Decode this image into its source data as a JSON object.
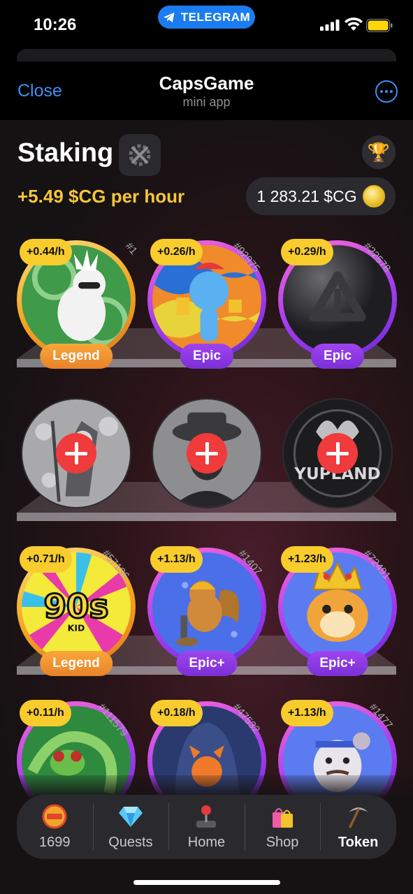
{
  "status_bar": {
    "time": "10:26",
    "pill_label": "TELEGRAM"
  },
  "header": {
    "close_label": "Close",
    "title": "CapsGame",
    "subtitle": "mini app"
  },
  "staking": {
    "title": "Staking",
    "rate_text": "+5.49 $CG per hour",
    "balance_text": "1 283.21 $CG"
  },
  "cards": [
    {
      "rate": "+0.44/h",
      "id": "#1",
      "rarity": "Legend",
      "tier": "legend"
    },
    {
      "rate": "+0.26/h",
      "id": "#92975",
      "rarity": "Epic",
      "tier": "epic"
    },
    {
      "rate": "+0.29/h",
      "id": "#22578",
      "rarity": "Epic",
      "tier": "epic"
    },
    {
      "empty": true,
      "art": "coins-figure"
    },
    {
      "empty": true,
      "art": "hat-man"
    },
    {
      "empty": true,
      "art": "yupland",
      "art_text": "YUPLAND"
    },
    {
      "rate": "+0.71/h",
      "id": "#57136",
      "rarity": "Legend",
      "tier": "legend",
      "art_text": "90s",
      "art_sub": "KID"
    },
    {
      "rate": "+1.13/h",
      "id": "#1407",
      "rarity": "Epic+",
      "tier": "epic"
    },
    {
      "rate": "+1.23/h",
      "id": "#72491",
      "rarity": "Epic+",
      "tier": "epic"
    },
    {
      "rate": "+0.11/h",
      "id": "#111579",
      "tier": "epic"
    },
    {
      "rate": "+0.18/h",
      "id": "#47532",
      "tier": "epic"
    },
    {
      "rate": "+1.13/h",
      "id": "#1477",
      "tier": "epic"
    }
  ],
  "nav": {
    "items": [
      {
        "label": "1699",
        "icon": "capsgame-logo-icon"
      },
      {
        "label": "Quests",
        "icon": "diamond-icon"
      },
      {
        "label": "Home",
        "icon": "joystick-icon"
      },
      {
        "label": "Shop",
        "icon": "shopping-bags-icon"
      },
      {
        "label": "Token",
        "icon": "pickaxe-icon",
        "active": true
      }
    ]
  },
  "colors": {
    "accent_blue": "#3d8ff5",
    "rate_yellow": "#f7c53a",
    "badge_yellow": "#f8cc2c",
    "legend_orange": "#f5a623",
    "epic_purple": "#a33bf0",
    "add_red": "#ef3b3b"
  }
}
